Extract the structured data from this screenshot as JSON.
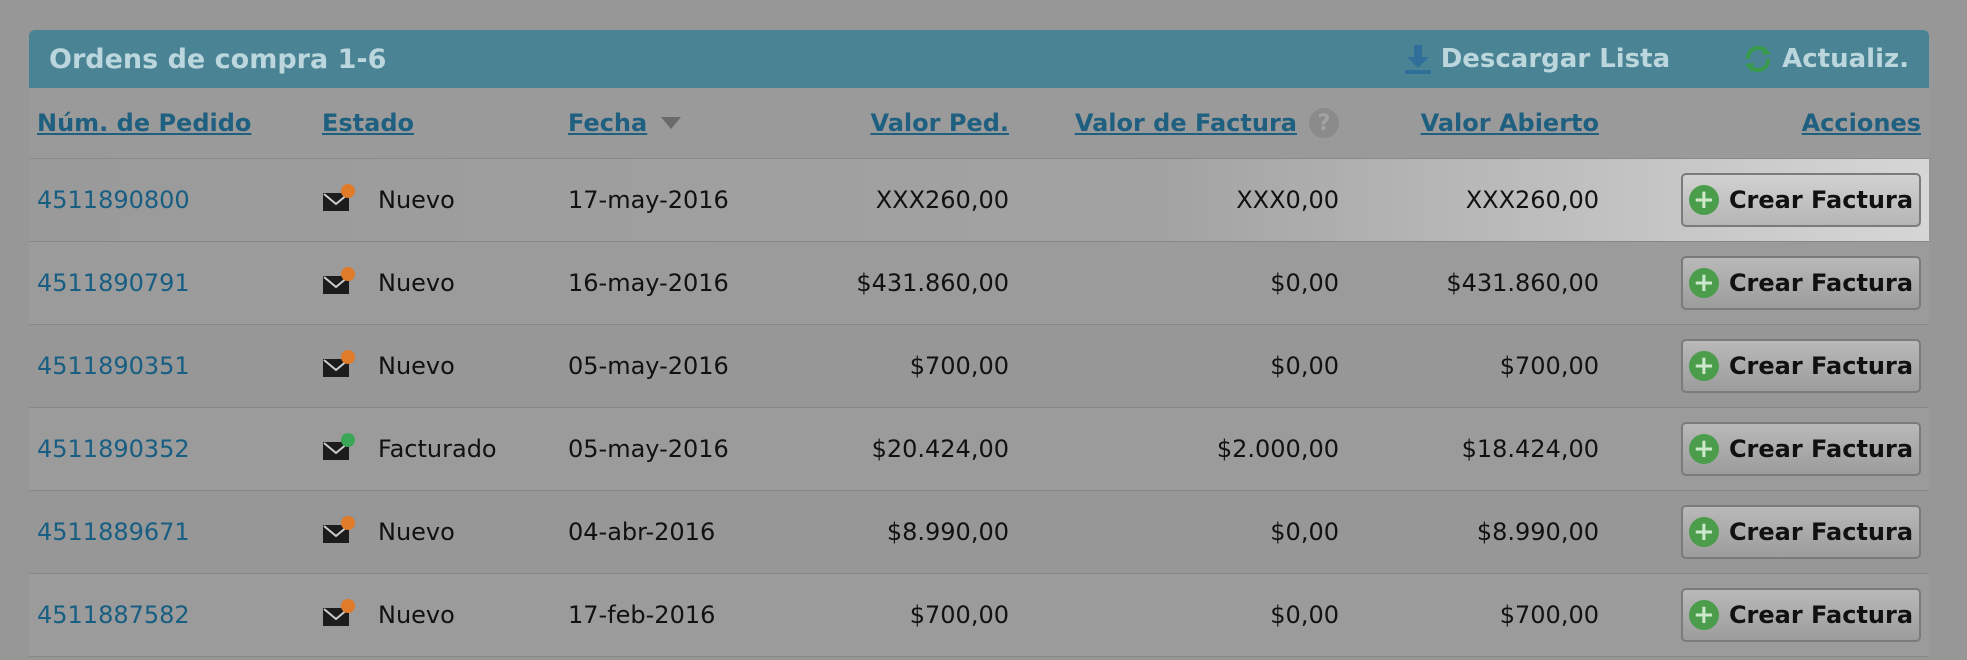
{
  "header": {
    "title": "Ordens de compra 1-6",
    "download_label": "Descargar Lista",
    "refresh_label": "Actualiz."
  },
  "columns": {
    "num": "Núm. de Pedido",
    "estado": "Estado",
    "fecha": "Fecha",
    "valor_ped": "Valor Ped.",
    "valor_factura": "Valor de Factura",
    "valor_abierto": "Valor Abierto",
    "acciones": "Acciones",
    "help_glyph": "?"
  },
  "rows": [
    {
      "num": "4511890800",
      "estado": "Nuevo",
      "status_icon": "new-envelope-icon",
      "fecha": "17-may-2016",
      "valor_ped": "XXX260,00",
      "valor_factura": "XXX0,00",
      "valor_abierto": "XXX260,00",
      "action": "Crear Factura"
    },
    {
      "num": "4511890791",
      "estado": "Nuevo",
      "status_icon": "new-envelope-icon",
      "fecha": "16-may-2016",
      "valor_ped": "$431.860,00",
      "valor_factura": "$0,00",
      "valor_abierto": "$431.860,00",
      "action": "Crear Factura"
    },
    {
      "num": "4511890351",
      "estado": "Nuevo",
      "status_icon": "new-envelope-icon",
      "fecha": "05-may-2016",
      "valor_ped": "$700,00",
      "valor_factura": "$0,00",
      "valor_abierto": "$700,00",
      "action": "Crear Factura"
    },
    {
      "num": "4511890352",
      "estado": "Facturado",
      "status_icon": "invoiced-envelope-icon",
      "fecha": "05-may-2016",
      "valor_ped": "$20.424,00",
      "valor_factura": "$2.000,00",
      "valor_abierto": "$18.424,00",
      "action": "Crear Factura"
    },
    {
      "num": "4511889671",
      "estado": "Nuevo",
      "status_icon": "new-envelope-icon",
      "fecha": "04-abr-2016",
      "valor_ped": "$8.990,00",
      "valor_factura": "$0,00",
      "valor_abierto": "$8.990,00",
      "action": "Crear Factura"
    },
    {
      "num": "4511887582",
      "estado": "Nuevo",
      "status_icon": "new-envelope-icon",
      "fecha": "17-feb-2016",
      "valor_ped": "$700,00",
      "valor_factura": "$0,00",
      "valor_abierto": "$700,00",
      "action": "Crear Factura"
    }
  ],
  "colors": {
    "titlebar": "#4a8494",
    "link": "#175e82",
    "plus_green": "#4b9d4b",
    "status_new_badge": "#e07b2a",
    "status_invoiced_badge": "#3aa657"
  }
}
